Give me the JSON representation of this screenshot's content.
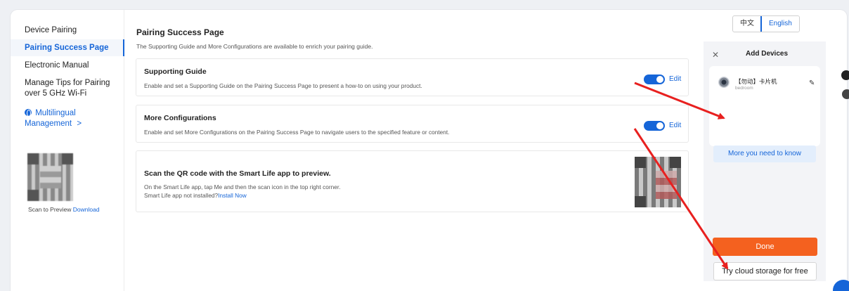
{
  "sidebar": {
    "items": [
      {
        "label": "Device Pairing"
      },
      {
        "label": "Pairing Success Page"
      },
      {
        "label": "Electronic Manual"
      },
      {
        "label": "Manage Tips for Pairing over 5 GHz Wi-Fi"
      },
      {
        "label": "Multilingual Management"
      }
    ],
    "chevron": ">",
    "scan_text": "Scan to Preview",
    "download_label": "Download"
  },
  "main": {
    "title": "Pairing Success Page",
    "subtitle": "The Supporting Guide and More Configurations are available to enrich your pairing guide.",
    "cards": [
      {
        "title": "Supporting Guide",
        "desc": "Enable and set a Supporting Guide on the Pairing Success Page to present a how-to on using your product.",
        "toggle_on": true,
        "edit_label": "Edit"
      },
      {
        "title": "More Configurations",
        "desc": "Enable and set More Configurations on the Pairing Success Page to navigate users to the specified feature or content.",
        "toggle_on": true,
        "edit_label": "Edit"
      }
    ],
    "qr_card": {
      "title": "Scan the QR code with the Smart Life app to preview.",
      "line1": "On the Smart Life app, tap Me and then the scan icon in the top right corner.",
      "line2_prefix": "Smart Life app not installed?",
      "install_label": "Install Now"
    }
  },
  "lang": {
    "zh": "中文",
    "en": "English",
    "active": "en"
  },
  "phone": {
    "close": "✕",
    "title": "Add Devices",
    "device_name": "【勿动】卡片机",
    "device_room": "bedroom",
    "more_label": "More you need to know",
    "done_label": "Done",
    "cloud_label": "Try cloud storage for free"
  },
  "colors": {
    "accent": "#1565d8",
    "done": "#f4611f",
    "arrow": "#e8201f"
  }
}
